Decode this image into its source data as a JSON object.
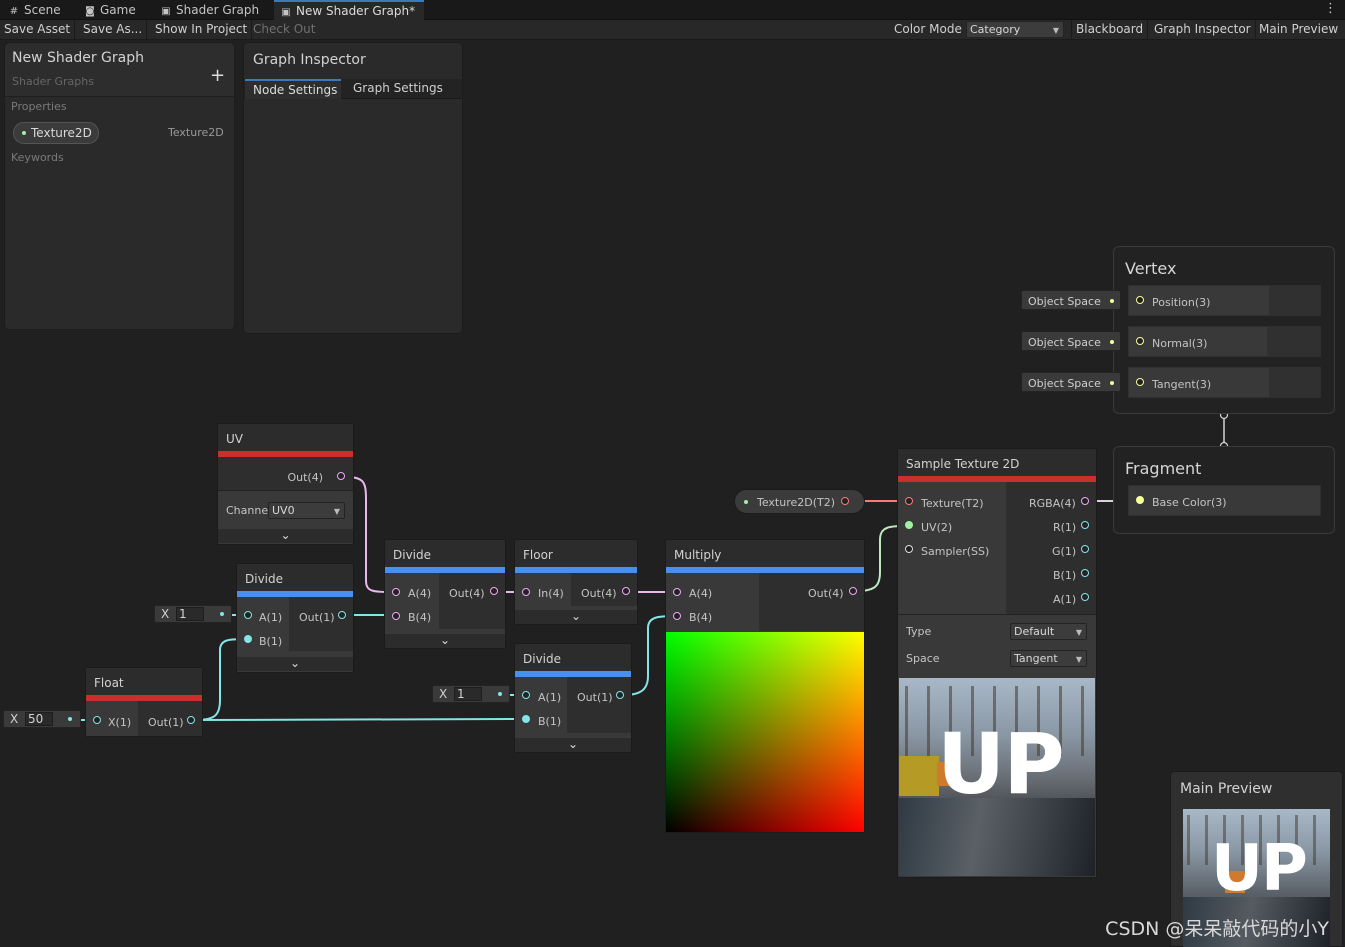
{
  "tabs": [
    {
      "label": "Scene",
      "icon": "grid-icon"
    },
    {
      "label": "Game",
      "icon": "gamepad-icon"
    },
    {
      "label": "Shader Graph",
      "icon": "shader-icon"
    },
    {
      "label": "New Shader Graph*",
      "icon": "shader-icon",
      "active": true
    }
  ],
  "toolbar": {
    "save_asset": "Save Asset",
    "save_as": "Save As...",
    "show_in_project": "Show In Project",
    "check_out": "Check Out",
    "color_mode_label": "Color Mode",
    "color_mode_value": "Category",
    "blackboard": "Blackboard",
    "graph_inspector": "Graph Inspector",
    "main_preview": "Main Preview"
  },
  "blackboard": {
    "title": "New Shader Graph",
    "subtitle": "Shader Graphs",
    "add": "+",
    "properties_label": "Properties",
    "property_name": "Texture2D",
    "property_type": "Texture2D",
    "keywords_label": "Keywords"
  },
  "inspector": {
    "title": "Graph Inspector",
    "tab_node": "Node Settings",
    "tab_graph": "Graph Settings"
  },
  "nodes": {
    "uv": {
      "title": "UV",
      "out": "Out(4)",
      "channel_label": "Channe",
      "channel_value": "UV0"
    },
    "divide_small": {
      "title": "Divide",
      "a": "A(1)",
      "b": "B(1)",
      "out": "Out(1)"
    },
    "float": {
      "title": "Float",
      "x": "X(1)",
      "out": "Out(1)"
    },
    "divide_main": {
      "title": "Divide",
      "a": "A(4)",
      "b": "B(4)",
      "out": "Out(4)"
    },
    "floor": {
      "title": "Floor",
      "in": "In(4)",
      "out": "Out(4)"
    },
    "divide_lower": {
      "title": "Divide",
      "a": "A(1)",
      "b": "B(1)",
      "out": "Out(1)"
    },
    "multiply": {
      "title": "Multiply",
      "a": "A(4)",
      "b": "B(4)",
      "out": "Out(4)"
    },
    "sample": {
      "title": "Sample Texture 2D",
      "texture": "Texture(T2)",
      "uv": "UV(2)",
      "sampler": "Sampler(SS)",
      "rgba": "RGBA(4)",
      "r": "R(1)",
      "g": "G(1)",
      "b": "B(1)",
      "a": "A(1)",
      "type_label": "Type",
      "type_value": "Default",
      "space_label": "Space",
      "space_value": "Tangent",
      "preview_text": "UP"
    },
    "texture_prop": {
      "label": "Texture2D(T2)"
    }
  },
  "inline_fields": {
    "x_label": "X",
    "divide_small_a": "1",
    "divide_lower_a": "1",
    "float_x": "50"
  },
  "master": {
    "vertex_title": "Vertex",
    "fragment_title": "Fragment",
    "position": "Position(3)",
    "normal": "Normal(3)",
    "tangent": "Tangent(3)",
    "base_color": "Base Color(3)",
    "object_space": "Object Space"
  },
  "main_preview": {
    "title": "Main Preview",
    "preview_text": "UP"
  },
  "watermark": "CSDN @呆呆敲代码的小Y",
  "colors": {
    "uv_category": "#c9302c",
    "math_category": "#4a8ff0",
    "texture_category": "#c9302c",
    "vec4_port": "#f0a8f8",
    "vec1_port": "#84e4e7",
    "vec2_port": "#9ff19f",
    "vec3_port": "#f6ff9a"
  }
}
